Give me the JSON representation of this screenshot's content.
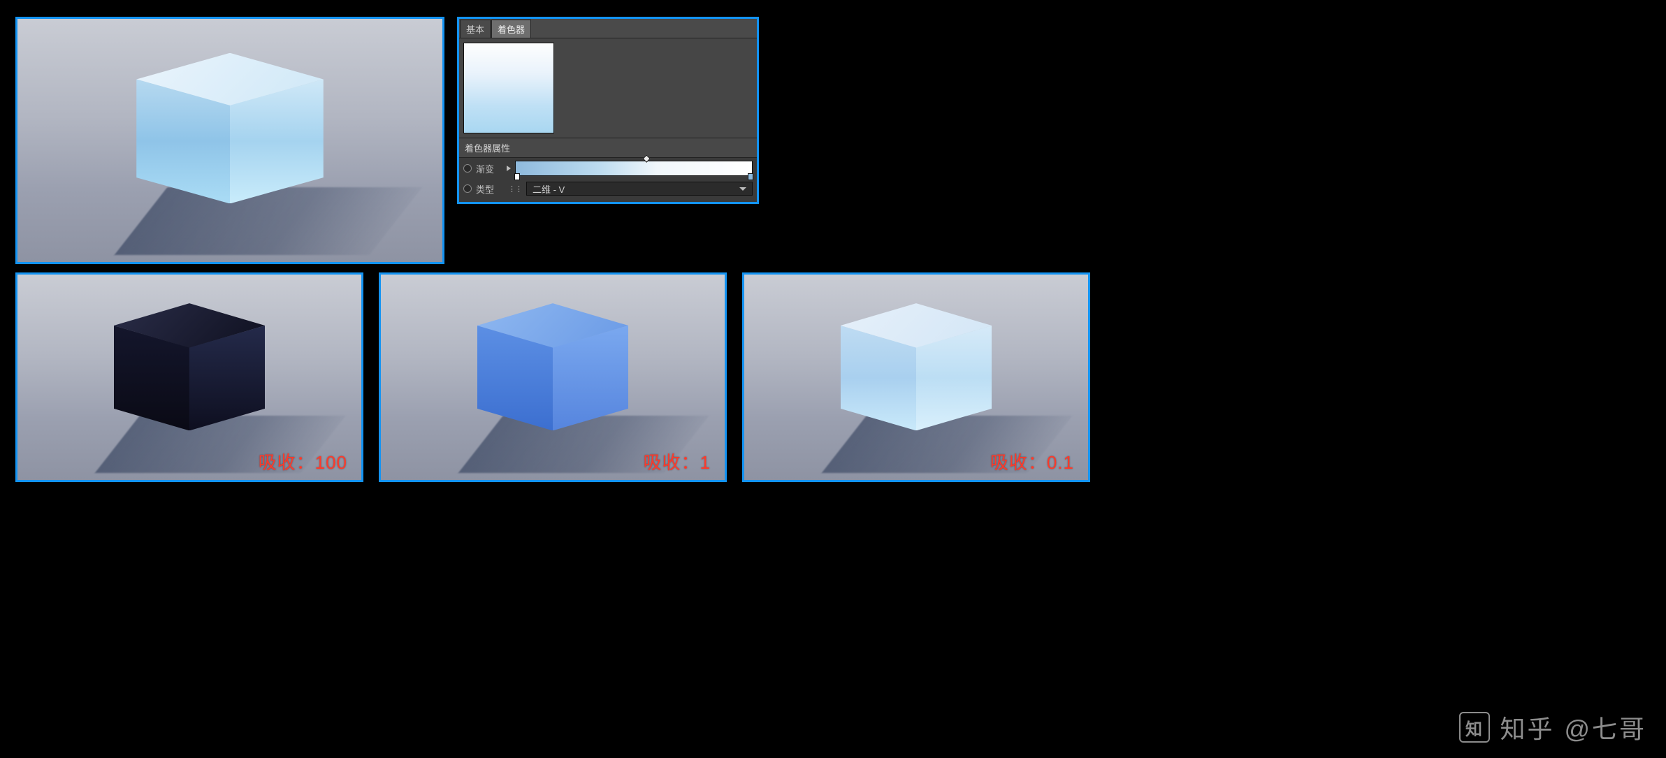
{
  "settings": {
    "tabs": {
      "basic": "基本",
      "shader": "着色器"
    },
    "section": "着色器属性",
    "gradient_label": "渐变",
    "type_label": "类型",
    "type_value": "二维 - V"
  },
  "renders": {
    "r1": {
      "caption_prefix": "吸收：",
      "caption_value": "100"
    },
    "r2": {
      "caption_prefix": "吸收：",
      "caption_value": "1"
    },
    "r3": {
      "caption_prefix": "吸收：",
      "caption_value": "0.1"
    }
  },
  "watermark": {
    "site": "知乎",
    "author": "@七哥",
    "logo": "知"
  }
}
